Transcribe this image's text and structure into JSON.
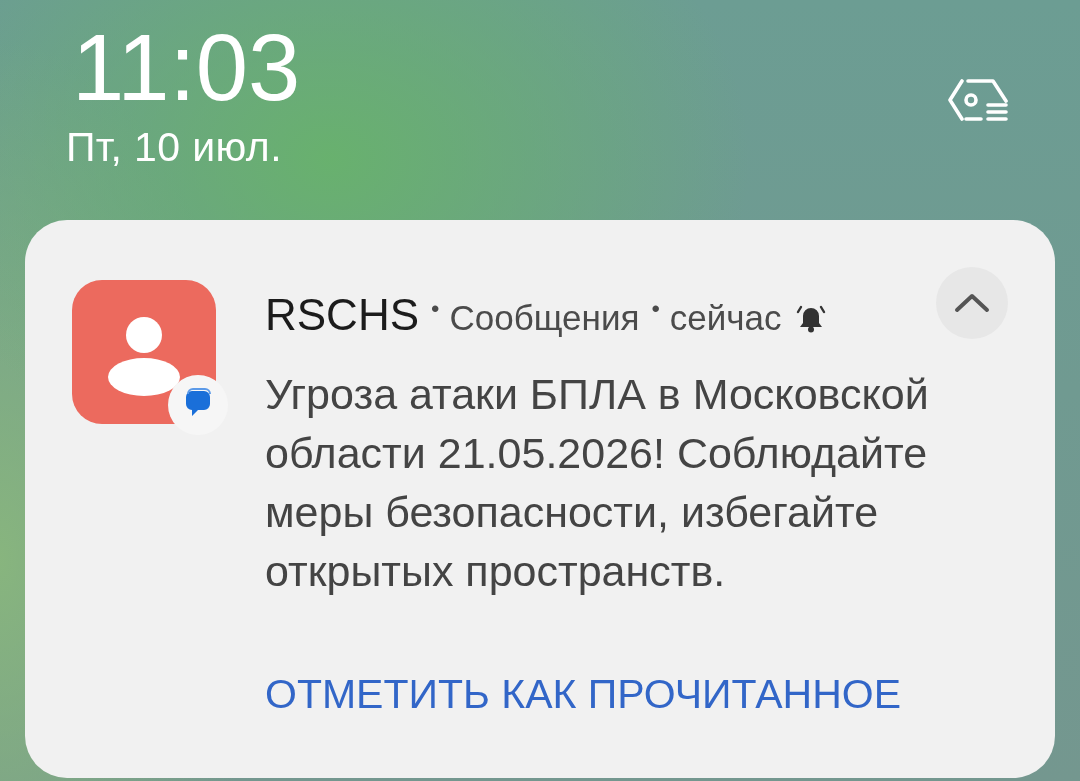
{
  "lock_screen": {
    "time": "11:03",
    "date": "Пт, 10 июл."
  },
  "notification": {
    "expanded": true,
    "header": [
      {
        "kind": "app",
        "text": "RSCHS"
      },
      {
        "kind": "separator",
        "text": "•"
      },
      {
        "kind": "meta",
        "text": "Сообщения"
      },
      {
        "kind": "separator",
        "text": "•"
      },
      {
        "kind": "meta",
        "text": "сейчас"
      }
    ],
    "message": "Угроза атаки БПЛА в Московской области 21.05.2026! Соблюдайте меры безопасности, избегайте открытых пространств.",
    "actions": [
      {
        "label": "ОТМЕТИТЬ КАК ПРОЧИТАННОЕ"
      }
    ]
  }
}
